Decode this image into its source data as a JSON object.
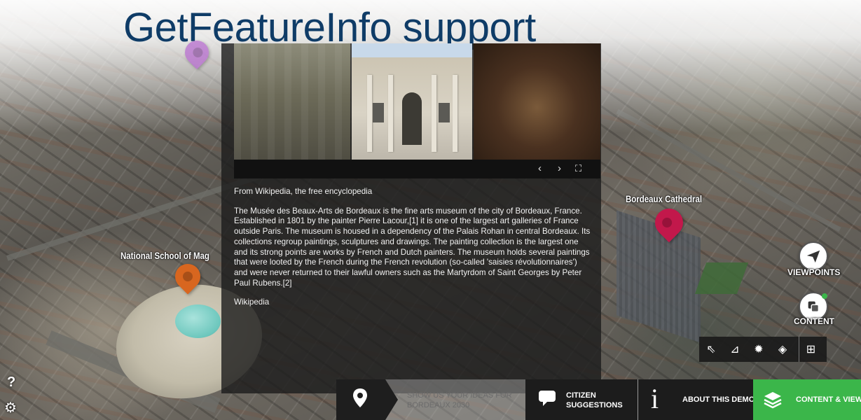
{
  "slide": {
    "title": "GetFeatureInfo support"
  },
  "markers": [
    {
      "label": "National School of Mag",
      "color": "#d8661f"
    },
    {
      "label": "Bordeaux Cathedral",
      "color": "#c2184b"
    },
    {
      "label": "",
      "color": "#b86fd0"
    }
  ],
  "popup": {
    "source_heading": "From Wikipedia, the free encyclopedia",
    "body": "The Musée des Beaux-Arts de Bordeaux is the fine arts museum of the city of Bordeaux, France. Established in 1801 by the painter Pierre Lacour,[1] it is one of the largest art galleries of France outside Paris. The museum is housed in a dependency of the Palais Rohan in central Bordeaux. Its collections regroup paintings, sculptures and drawings. The painting collection is the largest one and its strong points are works by French and Dutch painters. The museum holds several paintings that were looted by the French during the French revolution (so-called 'saisies révolutionnaires') and were never returned to their lawful owners such as the Martyrdom of Saint Georges by Peter Paul Rubens.[2]",
    "footer": "Wikipedia",
    "gallery_controls": {
      "prev": "‹",
      "next": "›",
      "fullscreen": "⛶"
    }
  },
  "side_buttons": {
    "viewpoints": "VIEWPOINTS",
    "content": "CONTENT"
  },
  "toolbar": [
    {
      "icon": "select-arrow-icon",
      "glyph": "⇖"
    },
    {
      "icon": "measure-angle-icon",
      "glyph": "⊿"
    },
    {
      "icon": "sun-icon",
      "glyph": "✹"
    },
    {
      "icon": "layers-icon",
      "glyph": "◈"
    },
    {
      "icon": "grid-icon",
      "glyph": "⊞"
    }
  ],
  "bottom_bar": {
    "ideas_line1": "SHOW US YOUR IDEAS FOR",
    "ideas_line2": "BORDEAUX 2030",
    "suggest_line1": "CITIZEN",
    "suggest_line2": "SUGGESTIONS",
    "about": "ABOUT THIS DEMO",
    "content_views": "CONTENT & VIEWS"
  },
  "corner": {
    "help": "?",
    "settings": "⚙"
  }
}
